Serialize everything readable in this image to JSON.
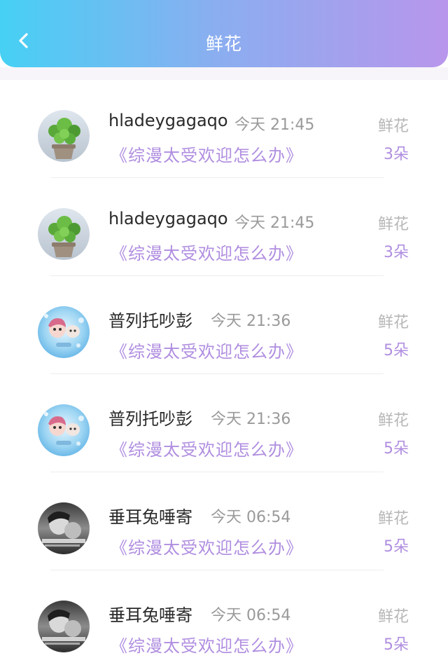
{
  "header": {
    "title": "鲜花",
    "back_icon": "chevron-left-icon"
  },
  "colors": {
    "header_gradient_start": "#46d0f4",
    "header_gradient_end": "#b896ec",
    "accent_purple": "#b08ee0",
    "name_text": "#2a2a2a",
    "muted_text": "#9a9a9a"
  },
  "records": [
    {
      "avatar": "plant-avatar",
      "name": "hladeygagaqo",
      "time": "今天 21:45",
      "book": "《综漫太受欢迎怎么办》",
      "gift_label": "鲜花",
      "gift_count": "3朵"
    },
    {
      "avatar": "plant-avatar",
      "name": "hladeygagaqo",
      "time": "今天 21:45",
      "book": "《综漫太受欢迎怎么办》",
      "gift_label": "鲜花",
      "gift_count": "3朵"
    },
    {
      "avatar": "cartoon-avatar",
      "name": "普列托吵彭",
      "time": "今天 21:36",
      "book": "《综漫太受欢迎怎么办》",
      "gift_label": "鲜花",
      "gift_count": "5朵"
    },
    {
      "avatar": "cartoon-avatar",
      "name": "普列托吵彭",
      "time": "今天 21:36",
      "book": "《综漫太受欢迎怎么办》",
      "gift_label": "鲜花",
      "gift_count": "5朵"
    },
    {
      "avatar": "photo-avatar",
      "name": "垂耳兔唾寄",
      "time": "今天 06:54",
      "book": "《综漫太受欢迎怎么办》",
      "gift_label": "鲜花",
      "gift_count": "5朵"
    },
    {
      "avatar": "photo-avatar",
      "name": "垂耳兔唾寄",
      "time": "今天 06:54",
      "book": "《综漫太受欢迎怎么办》",
      "gift_label": "鲜花",
      "gift_count": "5朵"
    }
  ]
}
